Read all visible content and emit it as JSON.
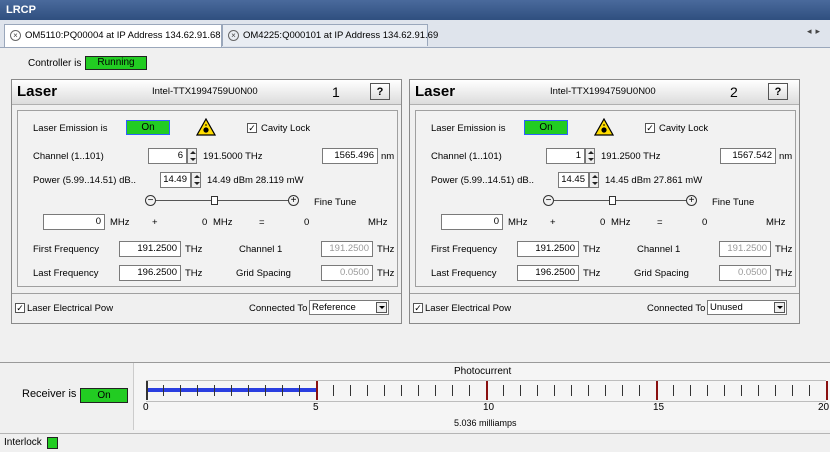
{
  "app_title": "LRCP",
  "tabs": [
    {
      "label": "OM5110:PQ00004   at IP Address 134.62.91.68"
    },
    {
      "label": "OM4225:Q000101   at IP Address 134.62.91.69"
    }
  ],
  "controller": {
    "label": "Controller is",
    "status": "Running"
  },
  "lasers": [
    {
      "name": "Laser",
      "model": "Intel-TTX1994759U0N00",
      "number": "1",
      "help": "?",
      "emission_label": "Laser Emission is",
      "emission_status": "On",
      "cavity_lock_label": "Cavity Lock",
      "cavity_lock_checked": true,
      "channel_label": "Channel (1..101)",
      "channel_value": "6",
      "channel_thz": "191.5000 THz",
      "wavelength_value": "1565.496",
      "wavelength_unit": "nm",
      "power_label": "Power (5.99..14.51) dB..",
      "power_value": "14.49",
      "power_readout": "14.49 dBm  28.119 mW",
      "fine_tune_label": "Fine Tune",
      "fine_mhz_value": "0",
      "mhz_unit": "MHz",
      "plus": "+",
      "offset": "0",
      "offset_unit": "MHz",
      "equals": "=",
      "total": "0",
      "total_unit": "MHz",
      "first_freq_label": "First Frequency",
      "first_freq_value": "191.2500",
      "thz_unit": "THz",
      "channel1_label": "Channel 1",
      "channel1_value": "191.2500",
      "last_freq_label": "Last Frequency",
      "last_freq_value": "196.2500",
      "grid_label": "Grid Spacing",
      "grid_value": "0.0500",
      "elec_power_label": "Laser Electrical Pow",
      "elec_power_checked": true,
      "connected_label": "Connected To",
      "connected_value": "Reference"
    },
    {
      "name": "Laser",
      "model": "Intel-TTX1994759U0N00",
      "number": "2",
      "help": "?",
      "emission_label": "Laser Emission is",
      "emission_status": "On",
      "cavity_lock_label": "Cavity Lock",
      "cavity_lock_checked": true,
      "channel_label": "Channel (1..101)",
      "channel_value": "1",
      "channel_thz": "191.2500 THz",
      "wavelength_value": "1567.542",
      "wavelength_unit": "nm",
      "power_label": "Power (5.99..14.51) dB..",
      "power_value": "14.45",
      "power_readout": "14.45 dBm  27.861 mW",
      "fine_tune_label": "Fine Tune",
      "fine_mhz_value": "0",
      "mhz_unit": "MHz",
      "plus": "+",
      "offset": "0",
      "offset_unit": "MHz",
      "equals": "=",
      "total": "0",
      "total_unit": "MHz",
      "first_freq_label": "First Frequency",
      "first_freq_value": "191.2500",
      "thz_unit": "THz",
      "channel1_label": "Channel 1",
      "channel1_value": "191.2500",
      "last_freq_label": "Last Frequency",
      "last_freq_value": "196.2500",
      "grid_label": "Grid Spacing",
      "grid_value": "0.0500",
      "elec_power_label": "Laser Electrical Pow",
      "elec_power_checked": true,
      "connected_label": "Connected To",
      "connected_value": "Unused"
    }
  ],
  "receiver": {
    "label": "Receiver is",
    "status": "On"
  },
  "photocurrent": {
    "title": "Photocurrent",
    "scale_labels": [
      "0",
      "5",
      "10",
      "15",
      "20"
    ],
    "max": 20,
    "value_fraction_of_scale": 5.036,
    "reading": "5.036 milliamps"
  },
  "interlock": {
    "label": "Interlock"
  },
  "colors": {
    "led_green": "#22cc22",
    "bar_blue": "#2a3ee0",
    "tick_red": "#8a1010"
  }
}
